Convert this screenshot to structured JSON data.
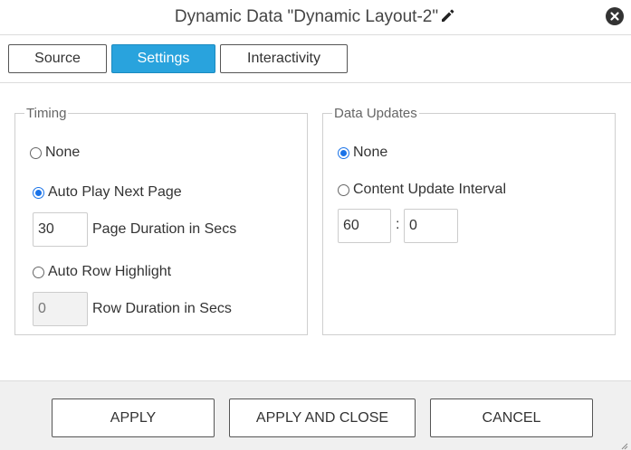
{
  "dialog": {
    "title": "Dynamic Data \"Dynamic Layout-2\""
  },
  "tabs": [
    {
      "label": "Source",
      "active": false
    },
    {
      "label": "Settings",
      "active": true
    },
    {
      "label": "Interactivity",
      "active": false
    }
  ],
  "timing": {
    "legend": "Timing",
    "options": {
      "none": {
        "label": "None",
        "checked": false
      },
      "auto_play": {
        "label": "Auto Play Next Page",
        "checked": true
      },
      "auto_row": {
        "label": "Auto Row Highlight",
        "checked": false
      }
    },
    "page_duration": {
      "value": "30",
      "label": "Page Duration in Secs"
    },
    "row_duration": {
      "value": "0",
      "label": "Row Duration in Secs",
      "disabled": true
    }
  },
  "data_updates": {
    "legend": "Data Updates",
    "options": {
      "none": {
        "label": "None",
        "checked": true
      },
      "interval": {
        "label": "Content Update Interval",
        "checked": false
      }
    },
    "interval_minutes": "60",
    "separator": ":",
    "interval_seconds": "0"
  },
  "footer": {
    "apply": "APPLY",
    "apply_close": "APPLY AND CLOSE",
    "cancel": "CANCEL"
  },
  "colors": {
    "accent": "#29a3dd",
    "radio_checked": "#1a73e8"
  },
  "icons": [
    "pencil-icon",
    "close-icon",
    "resize-grip-icon"
  ]
}
